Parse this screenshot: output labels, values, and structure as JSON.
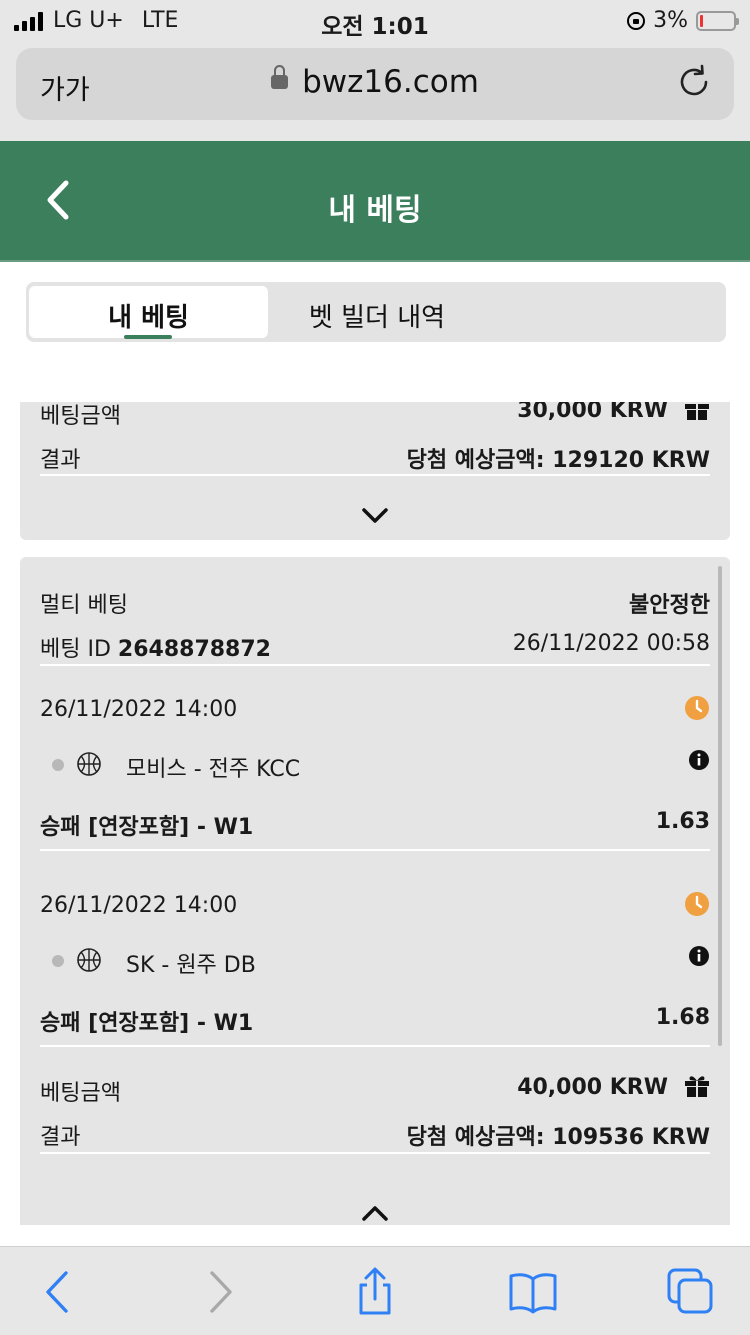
{
  "status_bar": {
    "carrier": "LG U+",
    "network": "LTE",
    "time": "오전 1:01",
    "battery_percent": "3%"
  },
  "browser": {
    "text_size_button": "가가",
    "url": "bwz16.com"
  },
  "header": {
    "title": "내 베팅"
  },
  "tabs": [
    {
      "label": "내 베팅",
      "active": true
    },
    {
      "label": "벳 빌더 내역",
      "active": false
    }
  ],
  "bet_prev": {
    "stake_label": "베팅금액",
    "stake_value": "30,000 KRW",
    "result_label": "결과",
    "result_value": "당첨 예상금액: 129120 KRW"
  },
  "bet_multi": {
    "type_label": "멀티 베팅",
    "status": "불안정한",
    "bet_id_label": "베팅 ID",
    "bet_id": "2648878872",
    "placed_at": "26/11/2022 00:58",
    "selections": [
      {
        "datetime": "26/11/2022 14:00",
        "match": "모비스 - 전주 KCC",
        "market": "승패 [연장포함] - W1",
        "odds": "1.63"
      },
      {
        "datetime": "26/11/2022 14:00",
        "match": "SK - 원주 DB",
        "market": "승패 [연장포함] - W1",
        "odds": "1.68"
      }
    ],
    "stake_label": "베팅금액",
    "stake_value": "40,000 KRW",
    "result_label": "결과",
    "result_value": "당첨 예상금액: 109536 KRW"
  },
  "colors": {
    "brand_green": "#3b7f5c",
    "pending_orange": "#f0a040",
    "ios_blue": "#2f7ff5"
  }
}
